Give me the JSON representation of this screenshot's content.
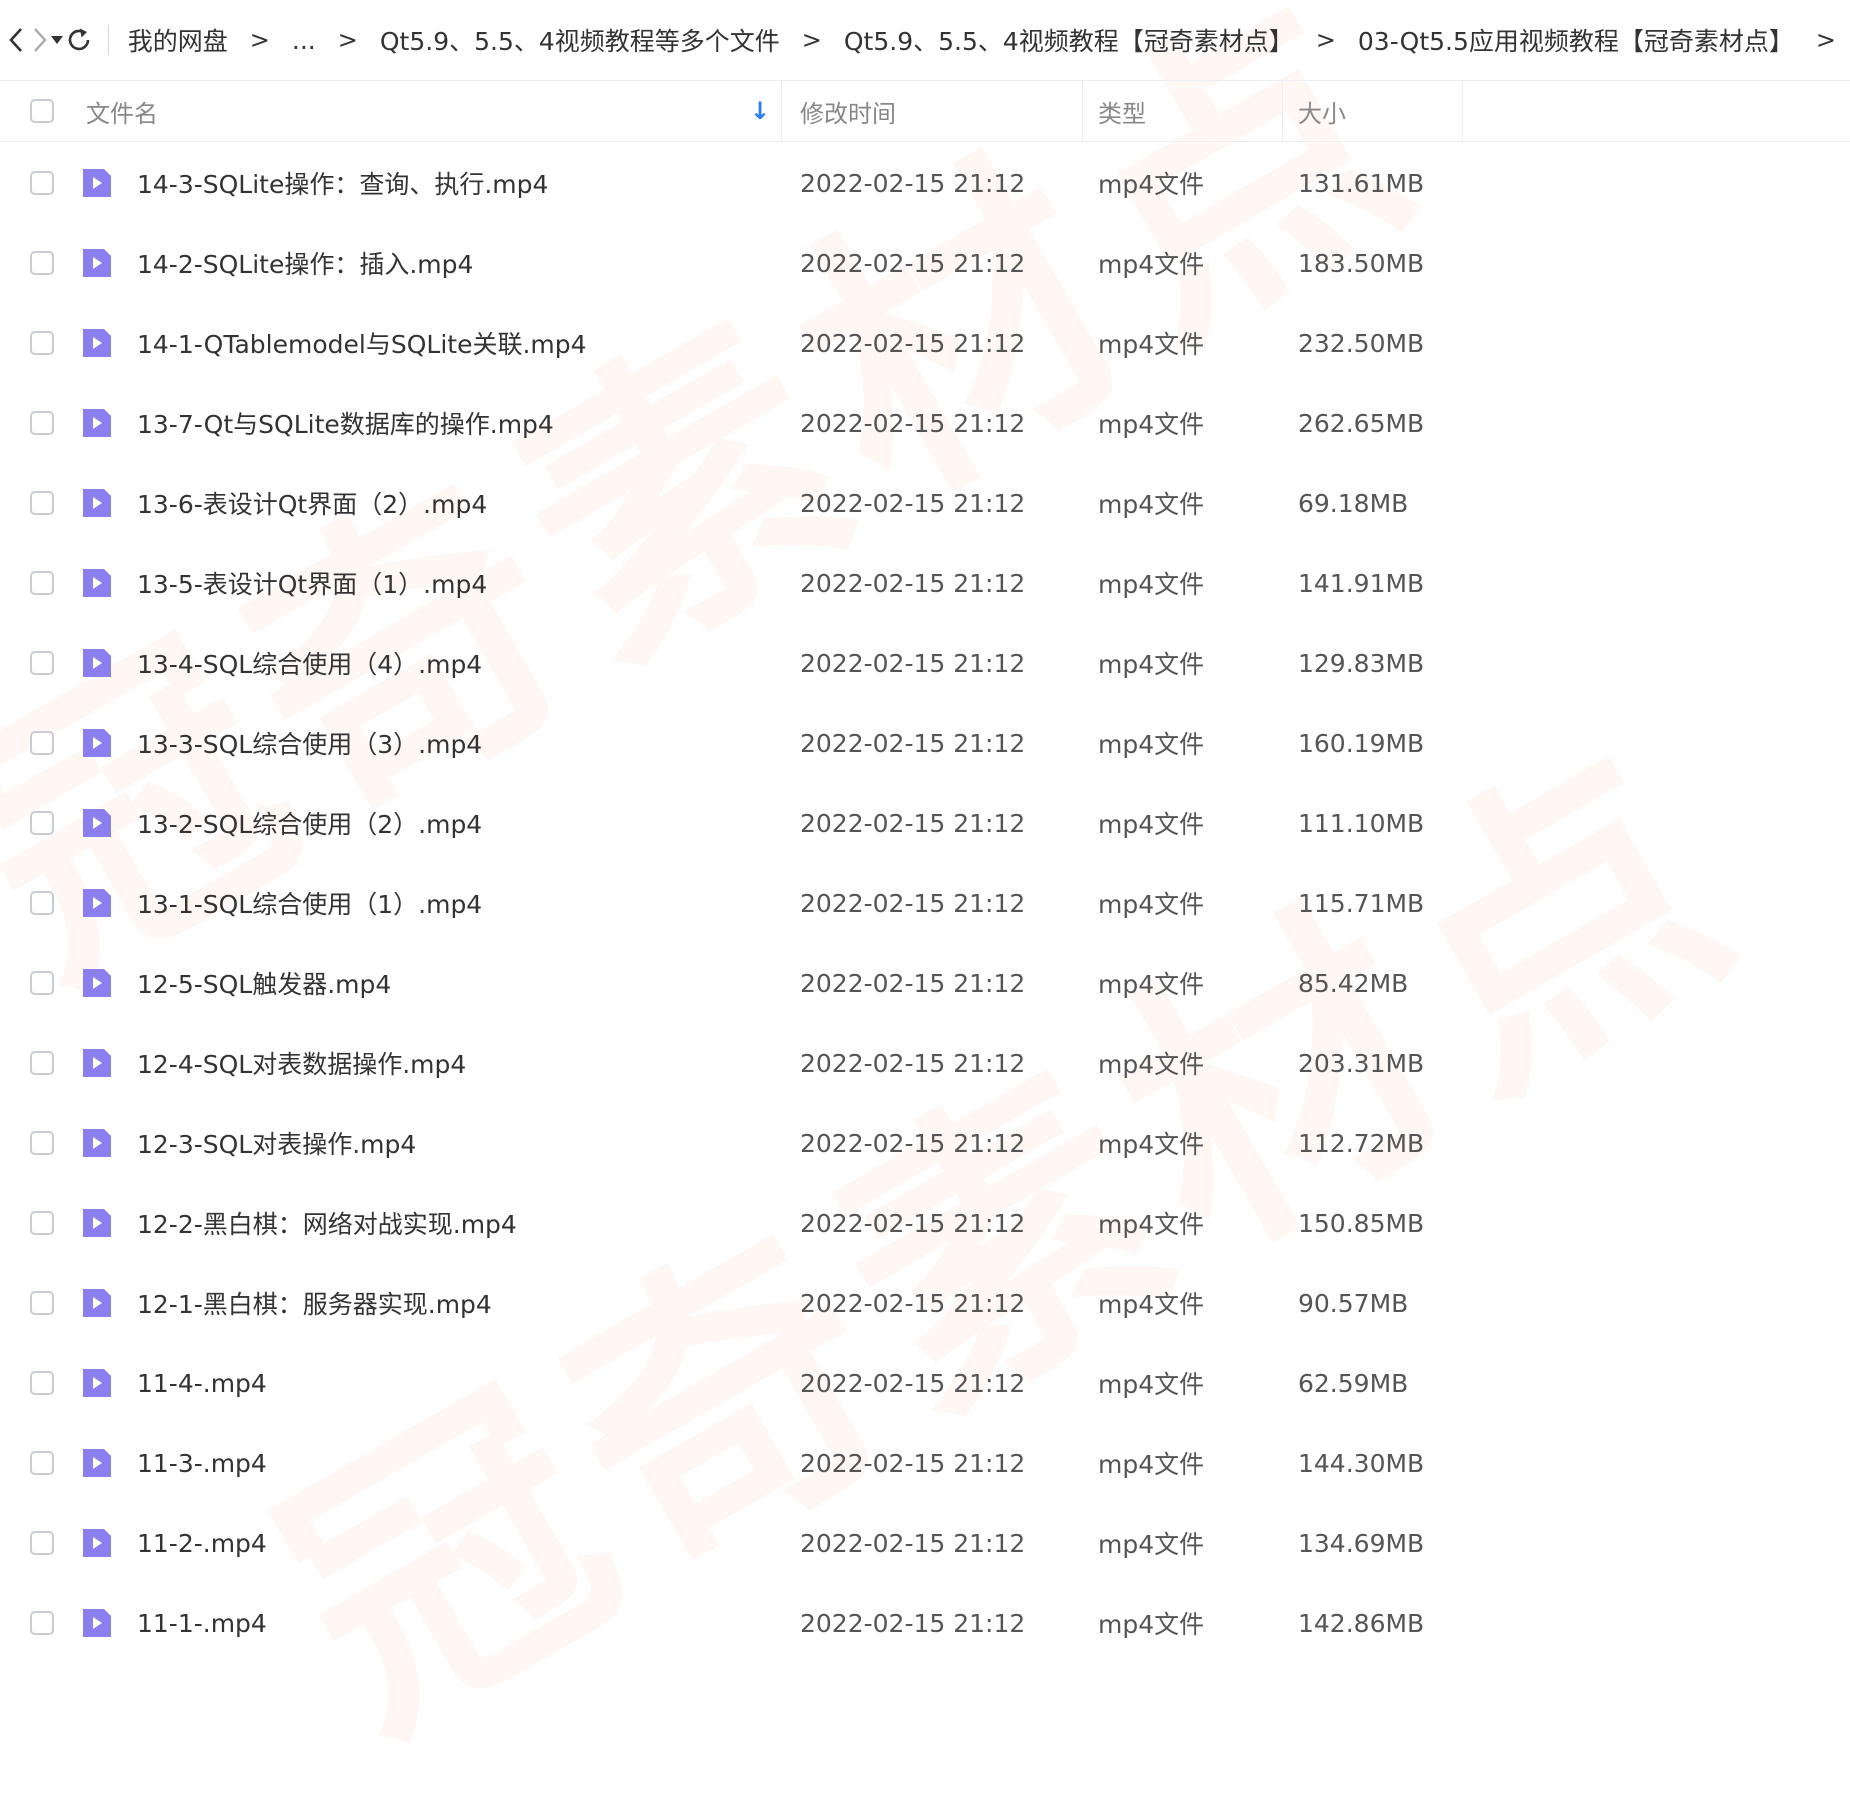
{
  "toolbar": {
    "back_icon": "chevron-left-icon",
    "forward_icon": "chevron-right-icon",
    "history_icon": "dropdown-triangle-icon",
    "refresh_icon": "refresh-icon"
  },
  "breadcrumb": {
    "items": [
      "我的网盘",
      "...",
      "Qt5.9、5.5、4视频教程等多个文件",
      "Qt5.9、5.5、4视频教程【冠奇素材点】",
      "03-Qt5.5应用视频教程【冠奇素材点】"
    ],
    "separator": ">"
  },
  "columns": {
    "name": "文件名",
    "mtime": "修改时间",
    "type": "类型",
    "size": "大小",
    "sort_indicator": "↓"
  },
  "watermark": "冠奇素材点",
  "colors": {
    "accent": "#2a7cf3",
    "file_icon": "#8b7ff0"
  },
  "files": [
    {
      "name": "14-3-SQLite操作：查询、执行.mp4",
      "mtime": "2022-02-15 21:12",
      "type": "mp4文件",
      "size": "131.61MB"
    },
    {
      "name": "14-2-SQLite操作：插入.mp4",
      "mtime": "2022-02-15 21:12",
      "type": "mp4文件",
      "size": "183.50MB"
    },
    {
      "name": "14-1-QTablemodel与SQLite关联.mp4",
      "mtime": "2022-02-15 21:12",
      "type": "mp4文件",
      "size": "232.50MB"
    },
    {
      "name": "13-7-Qt与SQLite数据库的操作.mp4",
      "mtime": "2022-02-15 21:12",
      "type": "mp4文件",
      "size": "262.65MB"
    },
    {
      "name": "13-6-表设计Qt界面（2）.mp4",
      "mtime": "2022-02-15 21:12",
      "type": "mp4文件",
      "size": "69.18MB"
    },
    {
      "name": "13-5-表设计Qt界面（1）.mp4",
      "mtime": "2022-02-15 21:12",
      "type": "mp4文件",
      "size": "141.91MB"
    },
    {
      "name": "13-4-SQL综合使用（4）.mp4",
      "mtime": "2022-02-15 21:12",
      "type": "mp4文件",
      "size": "129.83MB"
    },
    {
      "name": "13-3-SQL综合使用（3）.mp4",
      "mtime": "2022-02-15 21:12",
      "type": "mp4文件",
      "size": "160.19MB"
    },
    {
      "name": "13-2-SQL综合使用（2）.mp4",
      "mtime": "2022-02-15 21:12",
      "type": "mp4文件",
      "size": "111.10MB"
    },
    {
      "name": "13-1-SQL综合使用（1）.mp4",
      "mtime": "2022-02-15 21:12",
      "type": "mp4文件",
      "size": "115.71MB"
    },
    {
      "name": "12-5-SQL触发器.mp4",
      "mtime": "2022-02-15 21:12",
      "type": "mp4文件",
      "size": "85.42MB"
    },
    {
      "name": "12-4-SQL对表数据操作.mp4",
      "mtime": "2022-02-15 21:12",
      "type": "mp4文件",
      "size": "203.31MB"
    },
    {
      "name": "12-3-SQL对表操作.mp4",
      "mtime": "2022-02-15 21:12",
      "type": "mp4文件",
      "size": "112.72MB"
    },
    {
      "name": "12-2-黑白棋：网络对战实现.mp4",
      "mtime": "2022-02-15 21:12",
      "type": "mp4文件",
      "size": "150.85MB"
    },
    {
      "name": "12-1-黑白棋：服务器实现.mp4",
      "mtime": "2022-02-15 21:12",
      "type": "mp4文件",
      "size": "90.57MB"
    },
    {
      "name": "11-4-.mp4",
      "mtime": "2022-02-15 21:12",
      "type": "mp4文件",
      "size": "62.59MB"
    },
    {
      "name": "11-3-.mp4",
      "mtime": "2022-02-15 21:12",
      "type": "mp4文件",
      "size": "144.30MB"
    },
    {
      "name": "11-2-.mp4",
      "mtime": "2022-02-15 21:12",
      "type": "mp4文件",
      "size": "134.69MB"
    },
    {
      "name": "11-1-.mp4",
      "mtime": "2022-02-15 21:12",
      "type": "mp4文件",
      "size": "142.86MB"
    }
  ]
}
